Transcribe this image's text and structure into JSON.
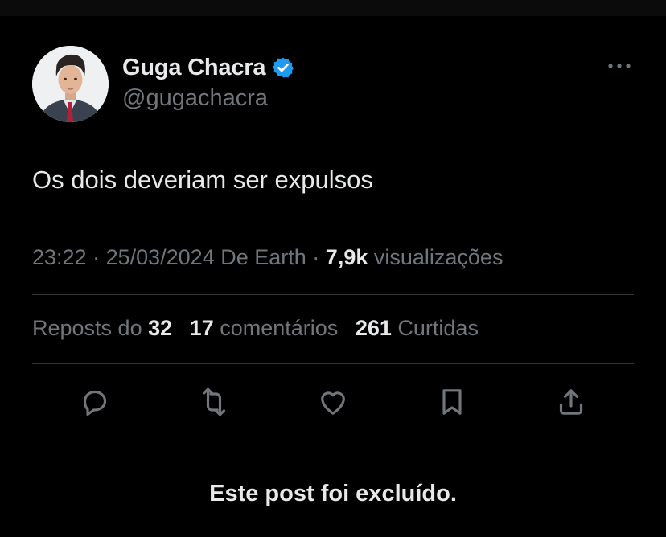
{
  "tweet": {
    "author_name": "Guga Chacra",
    "handle": "@gugachacra",
    "text": "Os dois deveriam ser expulsos",
    "time": "23:22",
    "separator": " · ",
    "date": "25/03/2024",
    "source": "De Earth",
    "views_count": "7,9k",
    "views_label": "visualizações"
  },
  "stats": {
    "reposts_label": "Reposts do",
    "reposts_count": "32",
    "comments_count": "17",
    "comments_label": "comentários",
    "likes_count": "261",
    "likes_label": "Curtidas"
  },
  "actions": [
    "reply-icon",
    "repost-icon",
    "like-icon",
    "bookmark-icon",
    "share-icon"
  ],
  "notice": "Este post foi excluído.",
  "colors": {
    "background": "#000000",
    "text": "#e7e9ea",
    "muted": "#71767b",
    "divider": "#2f3336",
    "verified": "#1d9bf0"
  }
}
